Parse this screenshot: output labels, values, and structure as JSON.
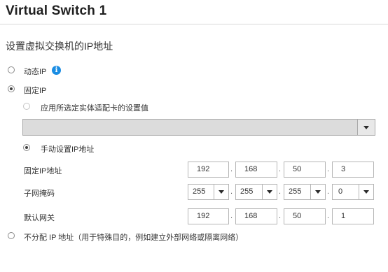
{
  "window": {
    "title": "Virtual Switch 1"
  },
  "section": {
    "heading": "设置虚拟交换机的IP地址"
  },
  "mode": {
    "dynamic_label": "动态IP",
    "fixed_label": "固定IP",
    "apply_adapter_label": "应用所选定实体适配卡的设置值",
    "adapter_select_value": "",
    "manual_label": "手动设置IP地址",
    "none_label": "不分配 IP 地址（用于特殊目的，例如建立外部网络或隔离网络）",
    "selected": "固定IP",
    "sub_selected": "手动设置IP地址"
  },
  "fields": {
    "ip_label": "固定IP地址",
    "ip": [
      "192",
      "168",
      "50",
      "3"
    ],
    "mask_label": "子网掩码",
    "mask": [
      "255",
      "255",
      "255",
      "0"
    ],
    "gateway_label": "默认网关",
    "gateway": [
      "192",
      "168",
      "50",
      "1"
    ],
    "separator": "."
  },
  "icons": {
    "info": "info-icon",
    "dropdown": "chevron-down-icon"
  },
  "colors": {
    "accent_info": "#1b8de3",
    "disabled_select_bg": "#dcdcdc"
  }
}
